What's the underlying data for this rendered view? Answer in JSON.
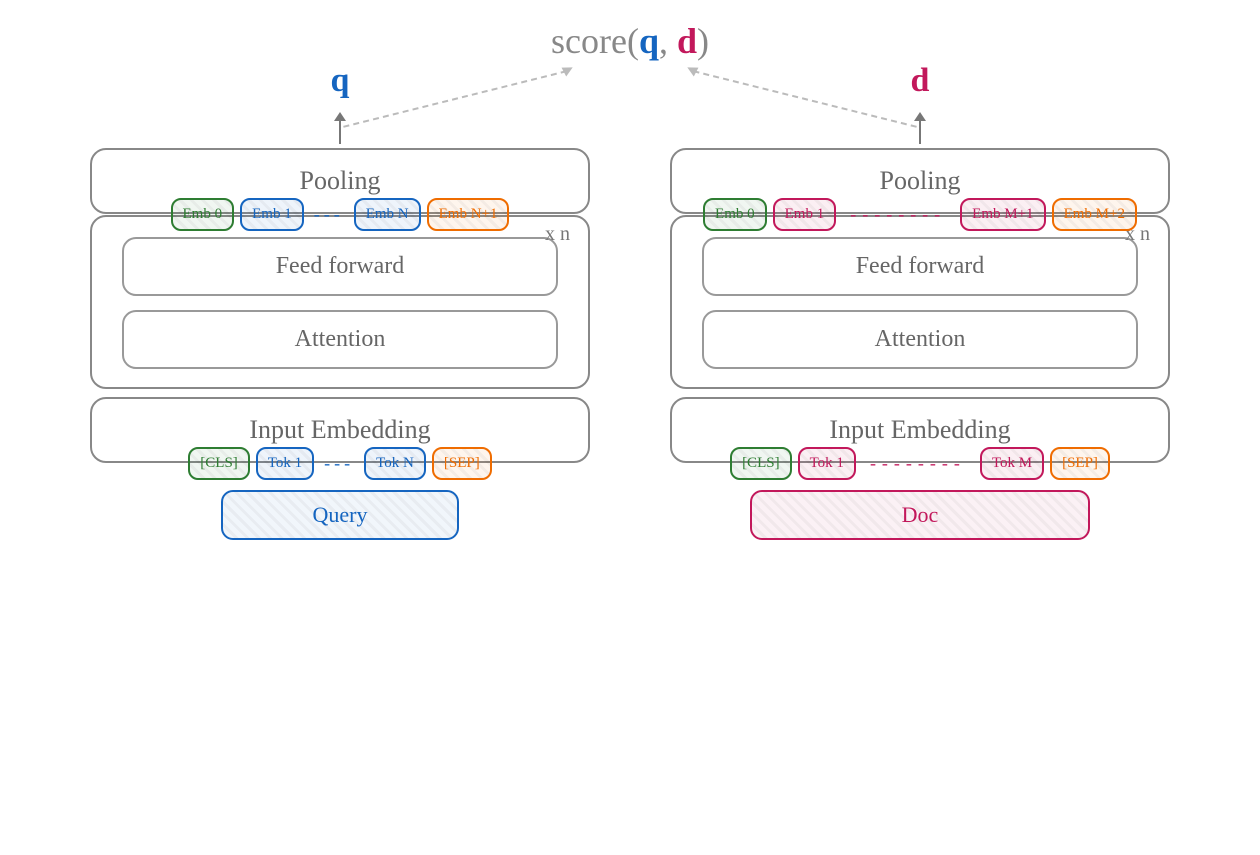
{
  "score": {
    "prefix": "score(",
    "q": "q",
    "comma": ", ",
    "d": "d",
    "suffix": ")"
  },
  "left": {
    "var": "q",
    "pooling": "Pooling",
    "emb": [
      "Emb 0",
      "Emb 1",
      "Emb N",
      "Emb N+1"
    ],
    "xn": "x n",
    "ff": "Feed forward",
    "att": "Attention",
    "input_emb": "Input Embedding",
    "tokens": [
      "[CLS]",
      "Tok 1",
      "Tok N",
      "[SEP]"
    ],
    "source": "Query"
  },
  "right": {
    "var": "d",
    "pooling": "Pooling",
    "emb": [
      "Emb 0",
      "Emb 1",
      "Emb M+1",
      "Emb M+2"
    ],
    "xn": "x n",
    "ff": "Feed forward",
    "att": "Attention",
    "input_emb": "Input Embedding",
    "tokens": [
      "[CLS]",
      "Tok 1",
      "Tok M",
      "[SEP]"
    ],
    "source": "Doc"
  }
}
